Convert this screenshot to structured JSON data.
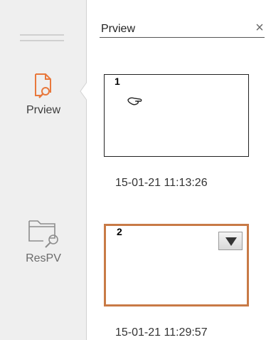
{
  "sidebar": {
    "menu_icon": "hamburger-icon",
    "items": [
      {
        "label": "Prview",
        "icon": "document-search-icon",
        "accent": "#e8783c",
        "active": true
      },
      {
        "label": "ResPV",
        "icon": "folder-search-icon",
        "active": false
      }
    ]
  },
  "panel": {
    "title": "Prview",
    "close_label": "×",
    "thumbnails": [
      {
        "index": "1",
        "timestamp": "15-01-21 11:13:26",
        "selected": false
      },
      {
        "index": "2",
        "timestamp": "15-01-21 11:29:57",
        "selected": true
      }
    ]
  },
  "colors": {
    "accent": "#e8783c",
    "selected_border": "#c87a46",
    "sidebar_bg": "#efefef"
  }
}
